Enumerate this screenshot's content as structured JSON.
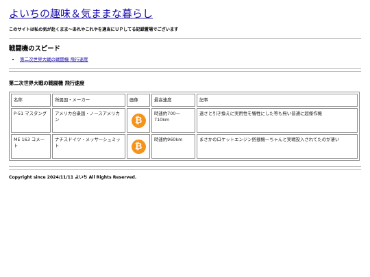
{
  "site": {
    "title": "よいちの趣味＆気ままな暮らし",
    "tagline": "このサイトは私の気が赴くまま～あれやこれやを適当にＵＰしてる記録置場でございます"
  },
  "section_title": "戦闘機のスピード",
  "toc": [
    {
      "label": "第二次世界大戦の戦闘機 飛行速度"
    }
  ],
  "table_title": "第二次世界大戦の戦闘機 飛行速度",
  "table": {
    "headers": [
      "名称",
      "所属国・メーカー",
      "画像",
      "最高速度",
      "記事"
    ],
    "rows": [
      {
        "name": "P-51 マスタング",
        "maker": "アメリカ合衆国・ノースアメリカン",
        "image_icon": "bitcoin-icon",
        "image_glyph": "₿",
        "speed": "時速約700～710km",
        "note": "速さと引き換えに実用性を犠牲にした等も無い普通に超傑作機"
      },
      {
        "name": "ME 163 コメート",
        "maker": "ナチスドイツ・メッサーシュミット",
        "image_icon": "bitcoin-icon",
        "image_glyph": "₿",
        "speed": "時速約960km",
        "note": "まさかのロケットエンジン搭載機～ちゃんと実戦投入されてたのが凄い"
      }
    ]
  },
  "footer": "Copyright since 2024/11/11 よいち All Rights Reserved.",
  "colors": {
    "link": "#1a0dab",
    "coin": "#f7931a",
    "border": "#8a8a8a"
  }
}
